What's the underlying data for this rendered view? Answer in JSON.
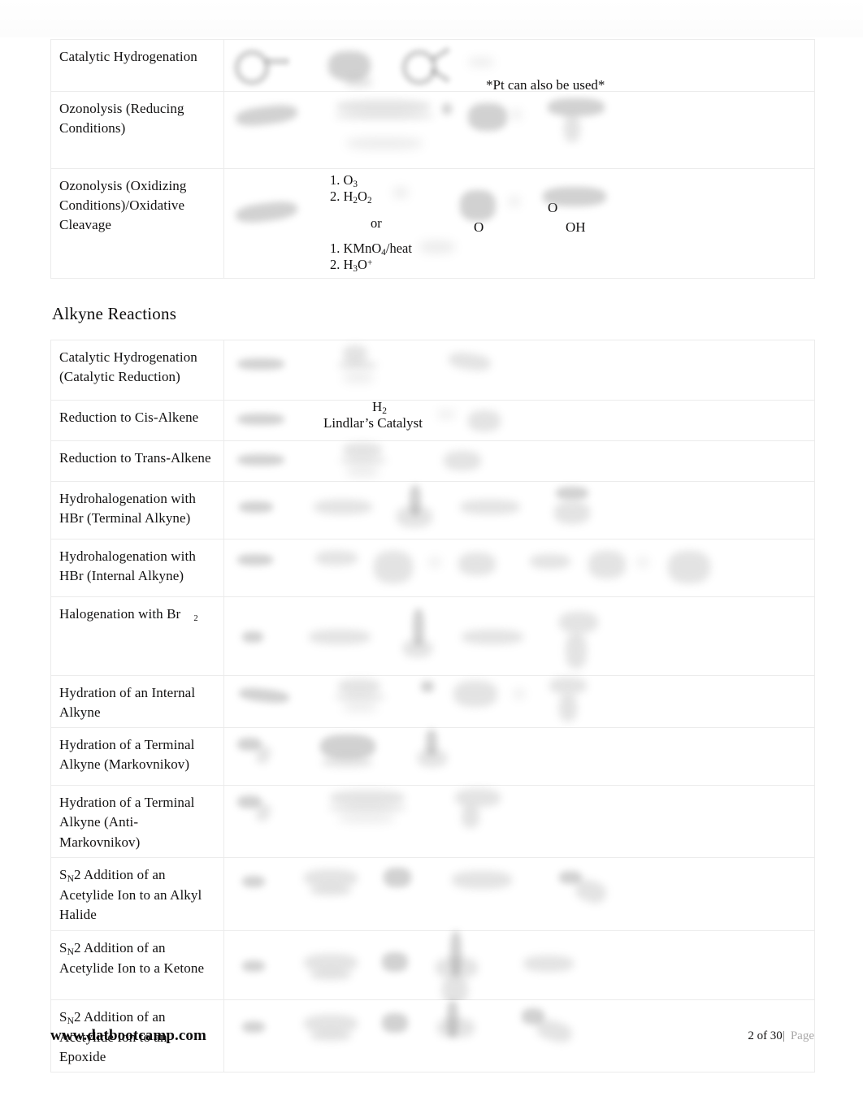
{
  "document": {
    "page_label": "2 of 30",
    "page_word": "Page",
    "separator": "|",
    "footer_url": "www.datbootcamp.com"
  },
  "alkene_table": {
    "rows": [
      {
        "name": "Catalytic Hydrogenation",
        "note": "*Pt can also be used*",
        "reagents": []
      },
      {
        "name": "Ozonolysis (Reducing Conditions)",
        "note": "",
        "reagents": []
      },
      {
        "name": "Ozonolysis (Oxidizing Conditions)/Oxidative Cleavage",
        "note": "",
        "reagents": [
          "1. O3",
          "2. H2O2",
          "or",
          "1. KMnO4/heat",
          "2. H3O+"
        ],
        "product_labels": [
          "O",
          "O",
          "OH"
        ]
      }
    ]
  },
  "heading_alkyne": "Alkyne Reactions",
  "alkyne_table": {
    "rows": [
      {
        "name": "Catalytic Hydrogenation (Catalytic Reduction)",
        "reagents": []
      },
      {
        "name": "Reduction to Cis-Alkene",
        "reagents": [
          "H2",
          "Lindlar’s Catalyst"
        ]
      },
      {
        "name": "Reduction to Trans-Alkene",
        "reagents": []
      },
      {
        "name": "Hydrohalogenation with HBr (Terminal Alkyne)",
        "reagents": []
      },
      {
        "name": "Hydrohalogenation with HBr (Internal Alkyne)",
        "reagents": []
      },
      {
        "name": "Halogenation with Br2",
        "reagents": []
      },
      {
        "name": "Hydration of an Internal Alkyne",
        "reagents": []
      },
      {
        "name": "Hydration of a Terminal Alkyne (Markovnikov)",
        "reagents": []
      },
      {
        "name": "Hydration of a Terminal Alkyne (Anti-Markovnikov)",
        "reagents": []
      },
      {
        "name": "SN2 Addition of an Acetylide Ion to an Alkyl Halide",
        "reagents": []
      },
      {
        "name": "SN2 Addition of an Acetylide Ion to a Ketone",
        "reagents": []
      },
      {
        "name": "SN2 Addition of an Acetylide Ion to an Epoxide",
        "reagents": []
      }
    ]
  },
  "colors": {
    "text": "#111010",
    "border": "#ebebeb",
    "muted": "#a8a7a7",
    "page_bg": "#ffffff"
  }
}
